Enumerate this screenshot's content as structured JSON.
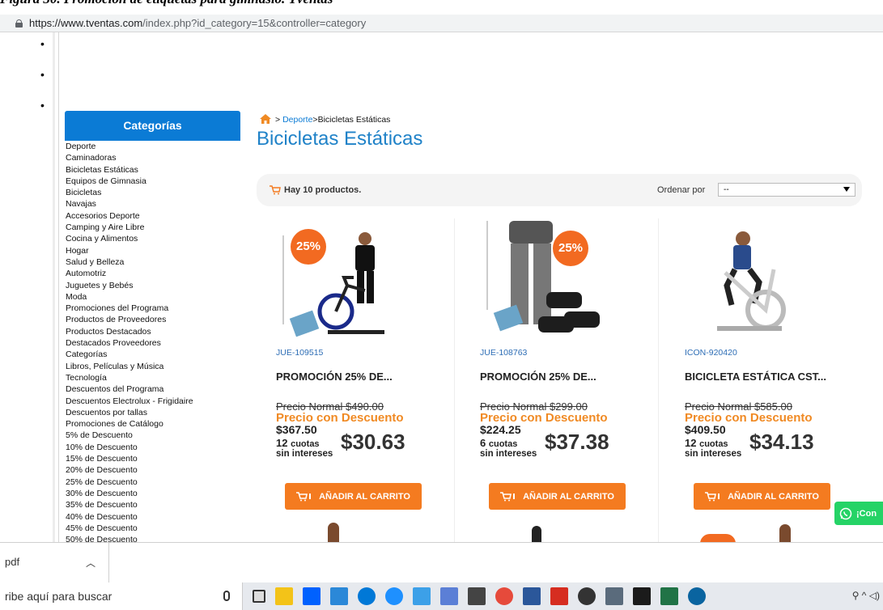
{
  "caption": "Figura 30. Promoción de etiquetas para gimnasio. Tventas",
  "browser": {
    "url_domain": "https://www.tventas.com",
    "url_path": "/index.php?id_category=15&controller=category"
  },
  "sidebar": {
    "title": "Categorías",
    "items": [
      "Deporte",
      "Caminadoras",
      "Bicicletas Estáticas",
      "Equipos de Gimnasia",
      "Bicicletas",
      "Navajas",
      "Accesorios Deporte",
      "Camping y Aire Libre",
      "Cocina y Alimentos",
      "Hogar",
      "Salud y Belleza",
      "Automotriz",
      "Juguetes y Bebés",
      "Moda",
      "Promociones del Programa",
      "Productos de Proveedores",
      "Productos Destacados",
      "Destacados Proveedores",
      "Categorías",
      "Libros, Películas y Música",
      "Tecnología",
      "Descuentos del Programa",
      "Descuentos Electrolux - Frigidaire",
      "Descuentos por tallas",
      "Promociones de Catálogo",
      "5% de Descuento",
      "10% de Descuento",
      "15% de Descuento",
      "20% de Descuento",
      "25% de Descuento",
      "30% de Descuento",
      "35% de Descuento",
      "40% de Descuento",
      "45% de Descuento",
      "50% de Descuento"
    ]
  },
  "breadcrumb": {
    "sep1": ">",
    "link": "Deporte",
    "sep2": ">",
    "current": "Bicicletas Estáticas"
  },
  "page_title": "Bicicletas Estáticas",
  "toolbar": {
    "count": "Hay 10 productos.",
    "sort_label": "Ordenar por",
    "sort_value": "--"
  },
  "products": [
    {
      "sku": "JUE-109515",
      "name": "PROMOCIÓN 25% DE...",
      "price_normal": "Precio Normal $490.00",
      "discount_label": "Precio con Descuento",
      "price_discount": "$367.50",
      "cuotas_n": "12",
      "cuotas_word": "cuotas",
      "sin_intereses": "sin intereses",
      "cuota_amount": "$30.63",
      "badge": "25%",
      "button": "AÑADIR AL CARRITO"
    },
    {
      "sku": "JUE-108763",
      "name": "PROMOCIÓN 25% DE...",
      "price_normal": "Precio Normal $299.00",
      "discount_label": "Precio con Descuento",
      "price_discount": "$224.25",
      "cuotas_n": "6",
      "cuotas_word": "cuotas",
      "sin_intereses": "sin intereses",
      "cuota_amount": "$37.38",
      "badge": "25%",
      "button": "AÑADIR AL CARRITO"
    },
    {
      "sku": "ICON-920420",
      "name": "BICICLETA ESTÁTICA CST...",
      "price_normal": "Precio Normal $585.00",
      "discount_label": "Precio con Descuento",
      "price_discount": "$409.50",
      "cuotas_n": "12",
      "cuotas_word": "cuotas",
      "sin_intereses": "sin intereses",
      "cuota_amount": "$34.13",
      "badge": "",
      "button": "AÑADIR AL CARRITO"
    }
  ],
  "whatsapp_label": "¡Con",
  "download_bar": {
    "filename": "pdf"
  },
  "taskbar": {
    "search_placeholder": "ribe aquí para buscar"
  },
  "colors": {
    "brand_blue": "#0b7bd5",
    "title_blue": "#1f82c8",
    "orange": "#f47b20",
    "discount_orange": "#f08a24",
    "whatsapp_green": "#25d366"
  }
}
